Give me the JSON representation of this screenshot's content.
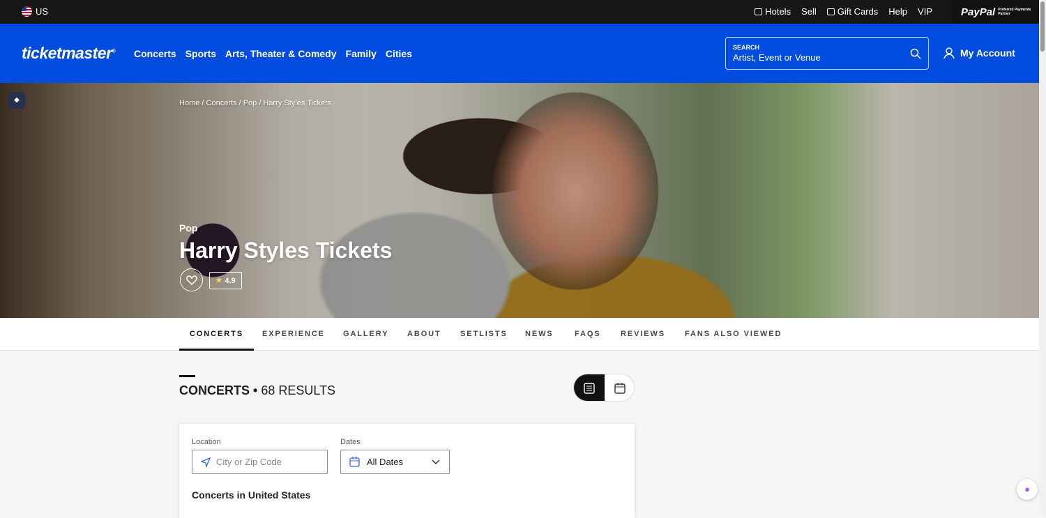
{
  "topbar": {
    "region": "US",
    "links": [
      "Hotels",
      "Sell",
      "Gift Cards",
      "Help",
      "VIP"
    ],
    "paypal_brand": "PayPal",
    "paypal_note": "Preferred Payments Partner"
  },
  "header": {
    "logo": "ticketmaster",
    "logo_mark": "®",
    "nav": [
      "Concerts",
      "Sports",
      "Arts, Theater & Comedy",
      "Family",
      "Cities"
    ],
    "search": {
      "label": "SEARCH",
      "placeholder": "Artist, Event or Venue"
    },
    "account": "My Account"
  },
  "hero": {
    "breadcrumb": "Home / Concerts / Pop / Harry Styles Tickets",
    "genre": "Pop",
    "title": "Harry Styles Tickets",
    "rating": "4.9"
  },
  "tabs": [
    "CONCERTS",
    "EXPERIENCE",
    "GALLERY",
    "ABOUT",
    "SETLISTS",
    "NEWS",
    "FAQS",
    "REVIEWS",
    "FANS ALSO VIEWED"
  ],
  "results": {
    "label": "CONCERTS",
    "separator": "•",
    "count": "68 RESULTS"
  },
  "filters": {
    "location_label": "Location",
    "location_placeholder": "City or Zip Code",
    "dates_label": "Dates",
    "dates_value": "All Dates",
    "section_title": "Concerts in United States"
  },
  "colors": {
    "primary": "#024ddf",
    "topbar": "#161616",
    "rating_star": "#ffd55a"
  },
  "icons": [
    "hotel-icon",
    "gift-card-icon",
    "search-icon",
    "user-icon",
    "heart-icon",
    "star-icon",
    "list-view-icon",
    "calendar-view-icon",
    "location-pin-icon",
    "calendar-icon",
    "chevron-down-icon"
  ]
}
